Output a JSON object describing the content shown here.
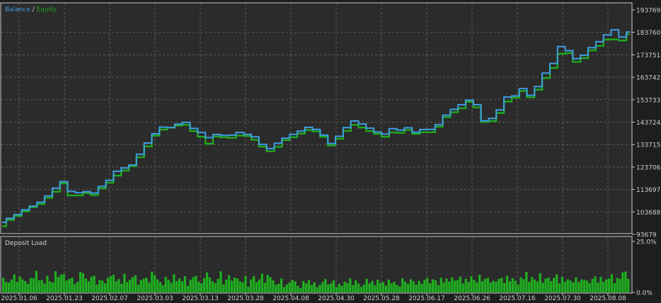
{
  "chart_data": [
    {
      "type": "line",
      "legend": {
        "balance_label": "Balance",
        "separator": " / ",
        "equity_label": "Equity",
        "placement": "top-left"
      },
      "series": [
        {
          "name": "Balance",
          "color": "#3d9fe0",
          "values": [
            99000,
            100800,
            102500,
            104600,
            106200,
            108000,
            110800,
            114300,
            117200,
            112800,
            112200,
            112700,
            112100,
            115100,
            117800,
            121800,
            123300,
            124600,
            129400,
            134400,
            138500,
            141500,
            141300,
            142800,
            143600,
            140900,
            139100,
            136800,
            138200,
            137800,
            137900,
            139100,
            138300,
            137200,
            133800,
            131900,
            134300,
            136600,
            138300,
            139700,
            141400,
            140500,
            137900,
            134200,
            137400,
            141300,
            144300,
            142900,
            141000,
            139300,
            138400,
            140800,
            140200,
            141200,
            139200,
            140400,
            140500,
            142600,
            146800,
            149400,
            151500,
            153500,
            151500,
            144300,
            145400,
            149200,
            154900,
            155400,
            158700,
            155700,
            159600,
            165600,
            169900,
            177400,
            175600,
            172000,
            173600,
            176900,
            179600,
            182600,
            184900,
            181700,
            183900
          ]
        },
        {
          "name": "Equity",
          "color": "#1fa81f",
          "values": [
            97300,
            100100,
            101900,
            103900,
            105800,
            107200,
            109900,
            112700,
            116400,
            111000,
            111000,
            112100,
            111200,
            114200,
            116700,
            119900,
            122100,
            124100,
            128100,
            132900,
            137700,
            140400,
            141300,
            142200,
            142500,
            139700,
            137200,
            134100,
            137300,
            136900,
            136700,
            137700,
            137500,
            135800,
            132800,
            130700,
            132700,
            135700,
            137000,
            138600,
            140200,
            139600,
            137200,
            133300,
            136300,
            139800,
            142500,
            141300,
            139700,
            138500,
            137200,
            139100,
            139000,
            140200,
            138500,
            139200,
            139200,
            141700,
            145900,
            148100,
            149900,
            152800,
            150300,
            143800,
            144200,
            147800,
            152900,
            154600,
            157600,
            154800,
            158200,
            163400,
            167900,
            174200,
            174500,
            170600,
            172300,
            175700,
            177700,
            180500,
            180600,
            180100,
            182900
          ]
        }
      ],
      "xlabels": [
        "2025.01.06",
        "2025.01.23",
        "2025.02.07",
        "2025.03.03",
        "2025.03.13",
        "2025.03.28",
        "2025.04.08",
        "2025.04.30",
        "2025.05.28",
        "2025.06.17",
        "2025.06.26",
        "2025.07.16",
        "2025.07.30",
        "2025.08.08"
      ],
      "y_ticks": [
        "193769",
        "183760",
        "173751",
        "163742",
        "153733",
        "143724",
        "133715",
        "123706",
        "113697",
        "103688",
        "93679"
      ],
      "ylim": [
        93679,
        193769
      ],
      "grid": true
    },
    {
      "type": "bar",
      "title": "Deposit Load",
      "color": "#1fae1f",
      "y_ticks": [
        "25.0%",
        "0.0%"
      ],
      "ylim": [
        0,
        25
      ],
      "values": [
        7.2,
        5.1,
        4.8,
        6.3,
        8.9,
        5.2,
        7.8,
        6.4,
        5.5,
        4.2,
        7.1,
        6.9,
        10.6,
        5.9,
        6.1,
        4.3,
        8.2,
        5.4,
        4.9,
        10.4,
        7.5,
        8.7,
        9.1,
        5.8,
        6.6,
        7.3,
        4.1,
        5.2,
        10.1,
        9.4,
        6.8,
        5.4,
        7.6,
        8.2,
        3.9,
        6.1,
        5.8,
        4.4,
        7.1,
        7.9,
        8.6,
        5.5,
        6.5,
        4.2,
        9.2,
        5.1,
        6.2,
        7.4,
        8.4,
        3.8,
        5.9,
        6.7,
        7.2,
        4.9,
        10.2,
        8.6,
        6.4,
        5.1,
        3.5,
        7.6,
        6.2,
        4.8,
        8.9,
        5.6,
        6.8,
        5.4,
        7.9,
        3.2,
        6.1,
        7.5,
        8.1,
        5.2,
        4.4,
        6.9,
        9.8,
        7.3,
        5.5,
        4.6,
        6.6,
        10.3,
        3.9,
        6.3,
        8.4,
        5.7,
        7.3,
        6.9,
        5.5,
        4.9,
        8.1,
        2.8,
        6.4,
        7.9,
        5.1,
        6.3,
        9.2,
        4.7,
        8.6,
        7.5,
        5.9,
        3.7,
        4.2,
        6.8,
        2.6,
        3.9,
        4.9,
        6.1,
        5.4,
        3.2,
        2.1,
        5.6,
        4.4,
        6.1,
        3.6,
        4.9,
        2.5,
        3.8,
        5.1,
        6.5,
        3.9,
        4.4,
        5.9,
        2.6,
        4.2,
        3.2,
        5.3,
        4.6,
        6.8,
        3.6,
        5.9,
        4.3,
        2.8,
        3.9,
        6.7,
        4.4,
        5.6,
        3.4,
        6.2,
        4.7,
        5.1,
        3.3,
        6.3,
        4.4,
        5.2,
        3.7,
        2.9,
        6.9,
        5.3,
        4.1,
        6.4,
        5.4,
        3.8,
        5.7,
        4.2,
        6.1,
        7.1,
        4.5,
        6.4,
        5.9,
        3.6,
        7.2,
        4.9,
        6.8,
        5.3,
        7.4,
        5.8,
        6.1,
        7.7,
        4.3,
        6.7,
        5.1,
        7.9,
        6.2,
        4.9,
        8.6,
        5.5,
        6.7,
        7.1,
        4.8,
        5.7,
        5.3,
        6.6,
        7.2,
        4.5,
        8.1,
        5.5,
        6.9,
        5.7,
        3.9,
        7.4,
        6.5,
        10.1,
        5.2,
        7.5,
        6.3,
        5.4,
        9.4,
        4.8,
        6.7,
        7.3,
        5.6,
        7.1,
        8.8,
        4.4,
        7.6,
        5.2,
        6.4,
        5.8,
        4.9,
        7.3,
        5.1,
        6.4,
        6.1,
        5.8,
        4.6,
        6.6,
        7.9,
        4.8,
        7.6,
        5.2,
        6.4,
        6.8,
        8.9,
        4.5,
        7.1,
        6.6,
        9.8,
        10.2,
        6.6
      ]
    }
  ]
}
